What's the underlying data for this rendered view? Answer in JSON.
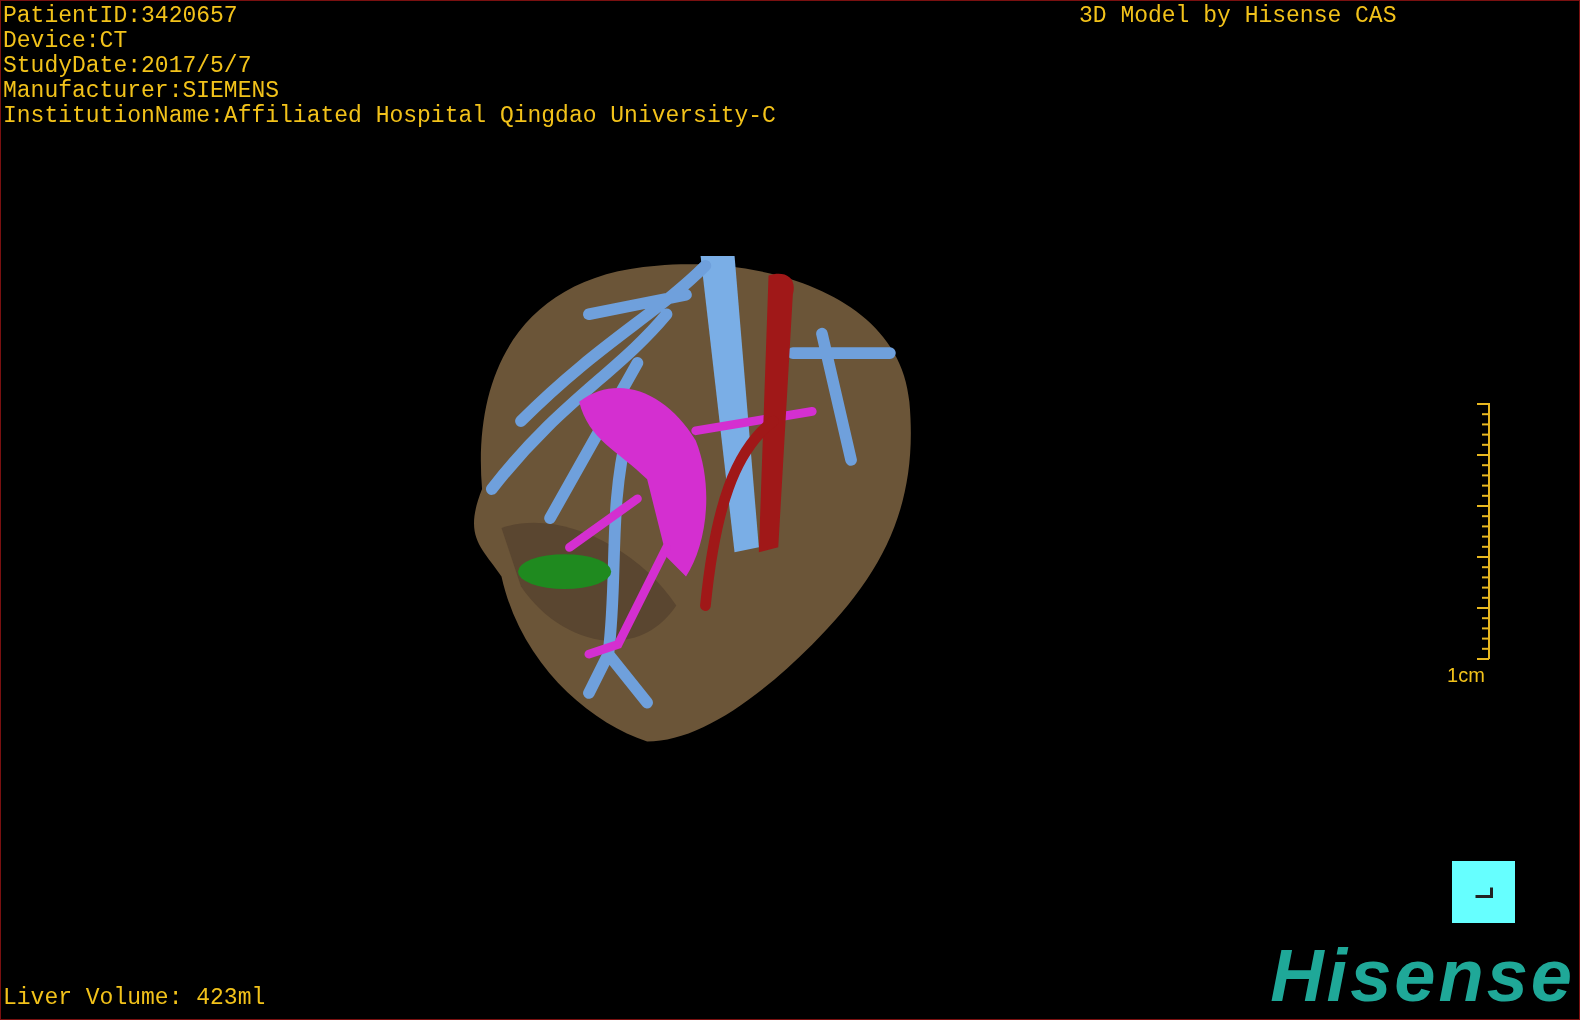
{
  "info_lines": [
    "PatientID:3420657",
    "Device:CT",
    "StudyDate:2017/5/7",
    "Manufacturer:SIEMENS",
    "InstitutionName:Affiliated Hospital Qingdao University-C"
  ],
  "model_credit": "3D Model by Hisense CAS",
  "scale_bar": {
    "label": "1cm"
  },
  "liver_volume": "Liver Volume: 423ml",
  "logo": "Hisense"
}
